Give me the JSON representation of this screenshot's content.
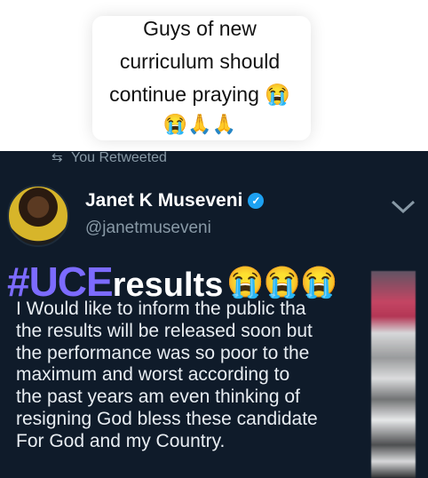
{
  "caption": {
    "lines": [
      "Guys of new",
      "curriculum should",
      "continue praying 😭"
    ],
    "emojis": "😭🙏🙏"
  },
  "tweet": {
    "retweet_label": "You Retweeted",
    "author_name": "Janet K Museveni",
    "author_handle": "@janetmuseveni",
    "hashtag_prefix": "#UCE",
    "hashtag_rest": "results",
    "hashtag_emojis": "😭😭😭",
    "body_lines": [
      "I Would like to inform the public tha",
      "the results will be released soon but",
      "the performance was so poor to the",
      "maximum and worst according to",
      "the past years am even thinking of",
      "resigning God bless these candidate",
      "For God and my Country."
    ]
  },
  "colors": {
    "tweet_bg": "#0f1b2a",
    "hashtag_accent": "#7c6bff",
    "verified_blue": "#1da1f2",
    "muted_text": "#8899a6"
  }
}
